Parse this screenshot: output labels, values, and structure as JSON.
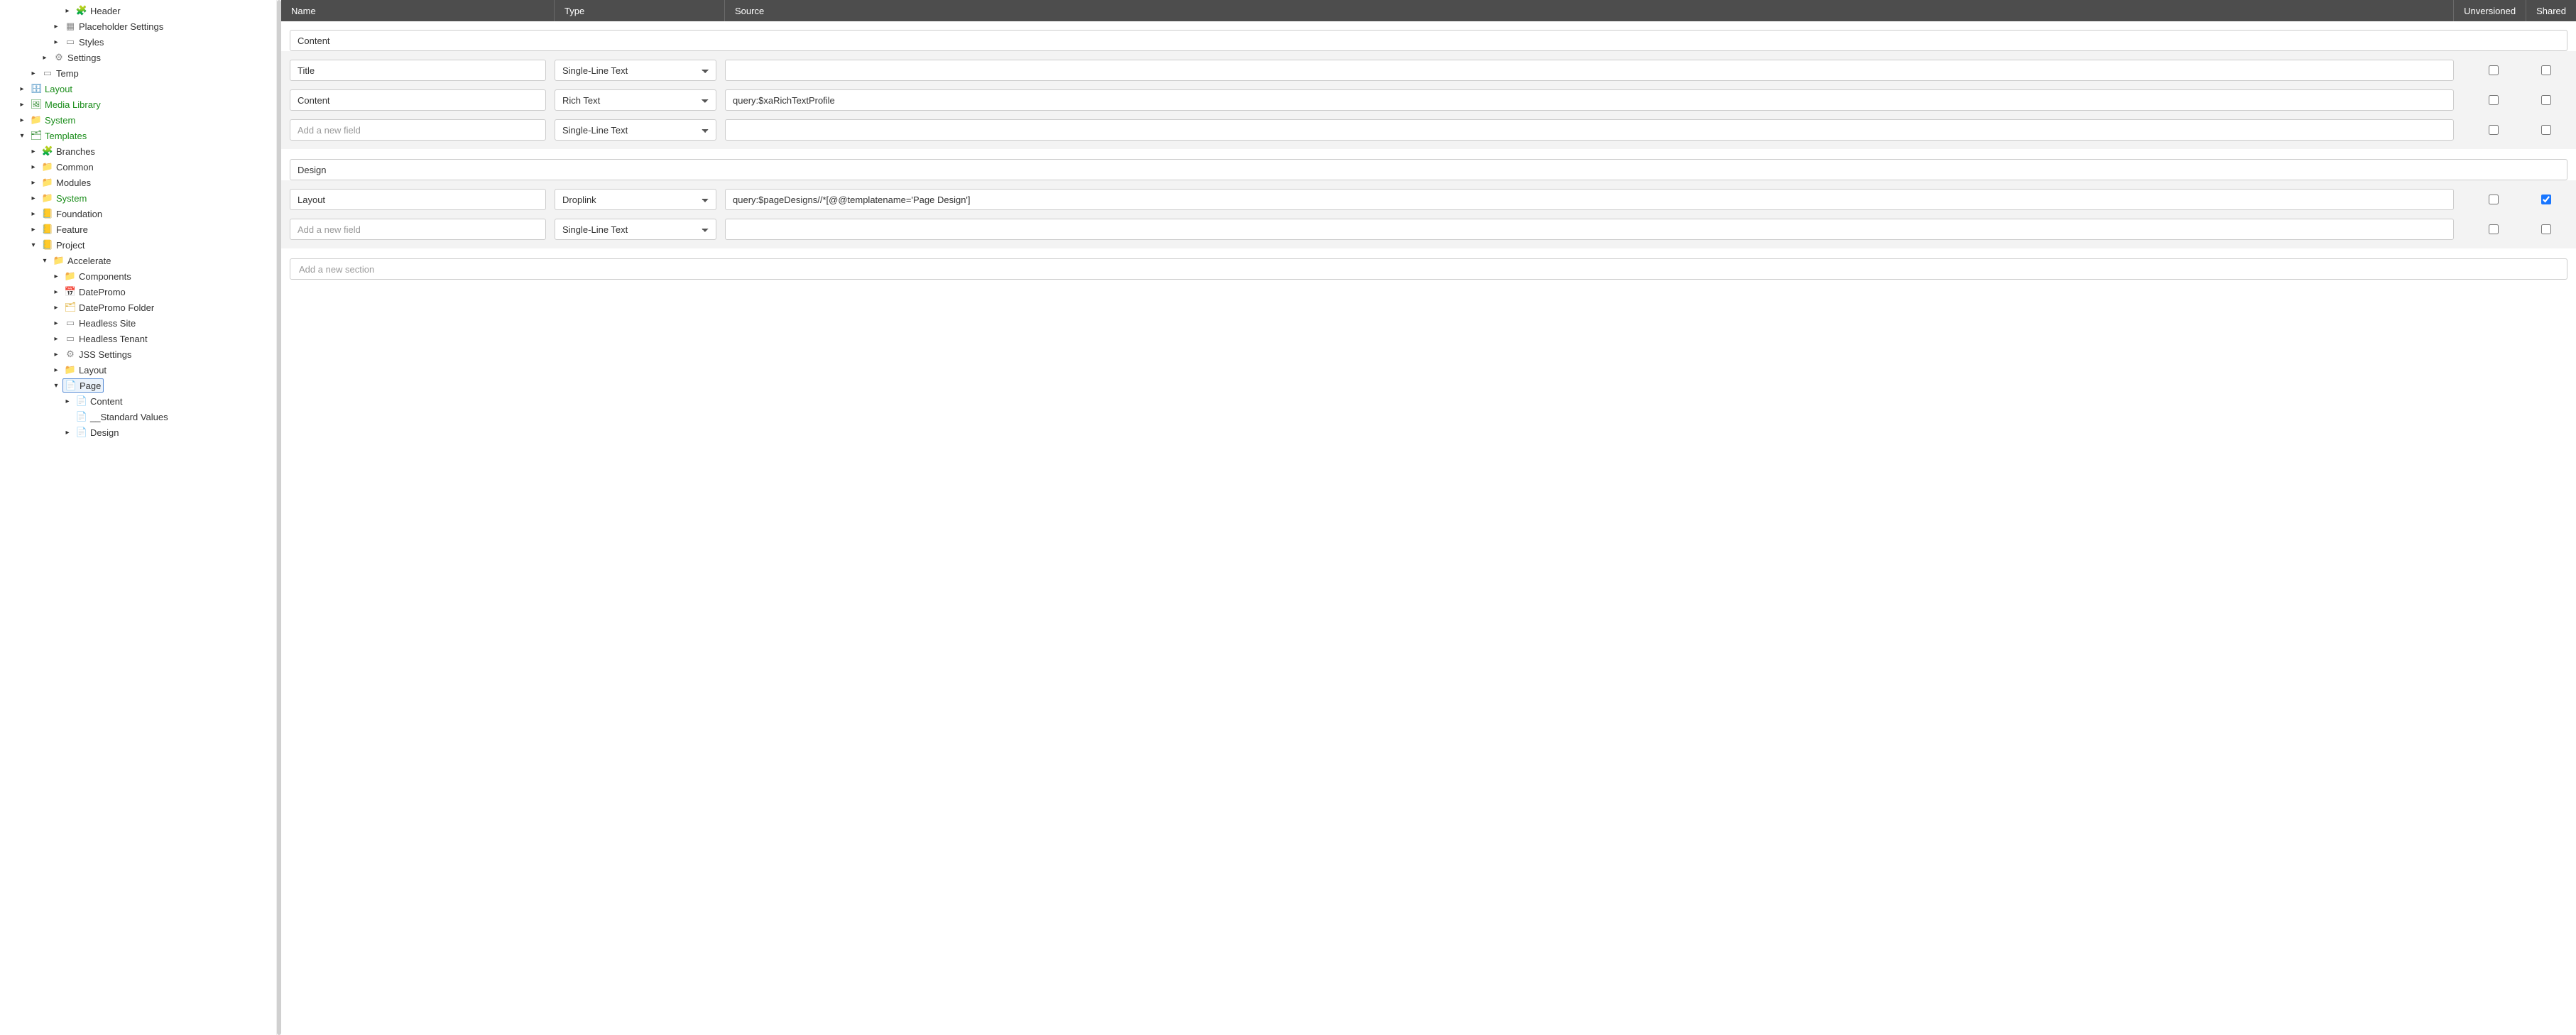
{
  "columns": {
    "name": "Name",
    "type": "Type",
    "source": "Source",
    "unversioned": "Unversioned",
    "shared": "Shared"
  },
  "typeOptions": [
    "Single-Line Text",
    "Rich Text",
    "Droplink"
  ],
  "placeholders": {
    "newField": "Add a new field",
    "newSection": "Add a new section"
  },
  "sections": [
    {
      "title": "Content",
      "fields": [
        {
          "name": "Title",
          "type": "Single-Line Text",
          "source": "",
          "unv": false,
          "sh": false
        },
        {
          "name": "Content",
          "type": "Rich Text",
          "source": "query:$xaRichTextProfile",
          "unv": false,
          "sh": false
        }
      ],
      "newRowType": "Single-Line Text"
    },
    {
      "title": "Design",
      "fields": [
        {
          "name": "Layout",
          "type": "Droplink",
          "source": "query:$pageDesigns//*[@@templatename='Page Design']",
          "unv": false,
          "sh": true
        }
      ],
      "newRowType": "Single-Line Text"
    }
  ],
  "tree": [
    {
      "depth": 5,
      "arrow": "right",
      "icon": "puzzle",
      "label": "Header"
    },
    {
      "depth": 4,
      "arrow": "right",
      "icon": "app",
      "label": "Placeholder Settings"
    },
    {
      "depth": 4,
      "arrow": "right",
      "icon": "win",
      "label": "Styles"
    },
    {
      "depth": 3,
      "arrow": "right",
      "icon": "gear",
      "label": "Settings"
    },
    {
      "depth": 2,
      "arrow": "right",
      "icon": "win",
      "label": "Temp"
    },
    {
      "depth": 1,
      "arrow": "right",
      "icon": "layout",
      "label": "Layout",
      "green": true
    },
    {
      "depth": 1,
      "arrow": "right",
      "icon": "media",
      "label": "Media Library",
      "green": true
    },
    {
      "depth": 1,
      "arrow": "right",
      "icon": "folder",
      "label": "System",
      "green": true
    },
    {
      "depth": 1,
      "arrow": "down",
      "icon": "template",
      "label": "Templates",
      "green": true
    },
    {
      "depth": 2,
      "arrow": "right",
      "icon": "puzzle",
      "label": "Branches"
    },
    {
      "depth": 2,
      "arrow": "right",
      "icon": "folder",
      "label": "Common"
    },
    {
      "depth": 2,
      "arrow": "right",
      "icon": "folder",
      "label": "Modules"
    },
    {
      "depth": 2,
      "arrow": "right",
      "icon": "folder",
      "label": "System",
      "green": true
    },
    {
      "depth": 2,
      "arrow": "right",
      "icon": "proj",
      "label": "Foundation"
    },
    {
      "depth": 2,
      "arrow": "right",
      "icon": "proj",
      "label": "Feature"
    },
    {
      "depth": 2,
      "arrow": "down",
      "icon": "proj",
      "label": "Project"
    },
    {
      "depth": 3,
      "arrow": "down",
      "icon": "folder",
      "label": "Accelerate"
    },
    {
      "depth": 4,
      "arrow": "right",
      "icon": "folder",
      "label": "Components"
    },
    {
      "depth": 4,
      "arrow": "right",
      "icon": "cal",
      "label": "DatePromo"
    },
    {
      "depth": 4,
      "arrow": "right",
      "icon": "folder-o",
      "label": "DatePromo Folder"
    },
    {
      "depth": 4,
      "arrow": "right",
      "icon": "win",
      "label": "Headless Site"
    },
    {
      "depth": 4,
      "arrow": "right",
      "icon": "win",
      "label": "Headless Tenant"
    },
    {
      "depth": 4,
      "arrow": "right",
      "icon": "gear",
      "label": "JSS Settings"
    },
    {
      "depth": 4,
      "arrow": "right",
      "icon": "folder",
      "label": "Layout"
    },
    {
      "depth": 4,
      "arrow": "down",
      "icon": "page",
      "label": "Page",
      "selected": true
    },
    {
      "depth": 5,
      "arrow": "right",
      "icon": "doc",
      "label": "Content"
    },
    {
      "depth": 5,
      "arrow": "blank",
      "icon": "doc",
      "label": "__Standard Values"
    },
    {
      "depth": 5,
      "arrow": "right",
      "icon": "doc",
      "label": "Design"
    }
  ],
  "iconGlyphs": {
    "folder": "📁",
    "folder-o": "🗂",
    "proj": "📒",
    "media": "🖼",
    "layout": "🗄",
    "template": "🗂",
    "puzzle": "🧩",
    "gear": "⚙",
    "win": "▭",
    "app": "▦",
    "page": "📄",
    "doc": "📄",
    "cal": "📅"
  }
}
